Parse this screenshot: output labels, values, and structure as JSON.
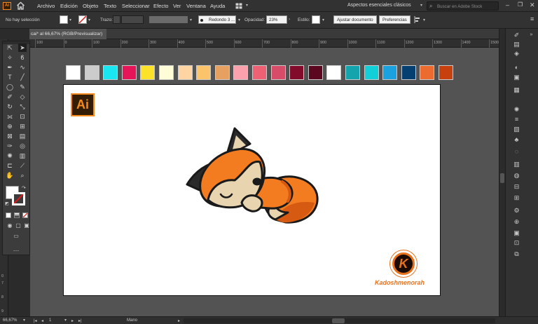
{
  "app": {
    "logo_text": "Ai",
    "home_icon": "home-icon"
  },
  "menu": {
    "items": [
      "Archivo",
      "Edición",
      "Objeto",
      "Texto",
      "Seleccionar",
      "Efecto",
      "Ver",
      "Ventana",
      "Ayuda"
    ],
    "workspace": "Aspectos esenciales clásicos",
    "search_placeholder": "Buscar en Adobe Stock"
  },
  "control": {
    "selection": "No hay selección",
    "stroke_label": "Trazo:",
    "brush": "Redondo 3 ...",
    "opacity_label": "Opacidad:",
    "opacity_value": "23%",
    "style_label": "Estilo:",
    "fit_button": "Ajustar documento",
    "prefs_button": "Preferencias"
  },
  "document": {
    "tab_title": "cai* al 66,67% (RGB/Previsualizar)"
  },
  "ruler": {
    "h_ticks": [
      "100",
      "0",
      "100",
      "200",
      "300",
      "400",
      "500",
      "600",
      "700",
      "800",
      "900",
      "1000",
      "1100",
      "1200",
      "1300",
      "1400",
      "1500"
    ],
    "v_ticks": [
      "0",
      "7",
      "8",
      "9"
    ]
  },
  "swatches": [
    "#ffffff",
    "#cccccc",
    "#19e6f0",
    "#e8145a",
    "#fde22a",
    "#fffcd8",
    "#fdd4a2",
    "#fbc46a",
    "#e6a161",
    "#fba1ad",
    "#ee6174",
    "#d74c68",
    "#820b2b",
    "#5b0720",
    "#ffffff",
    "#14a4ae",
    "#12d0d8",
    "#1aa1e0",
    "#053f71",
    "#ec6b2e",
    "#c7400e"
  ],
  "artboard": {
    "ai_badge": "Ai",
    "ai_badge_bg": "#331e05",
    "ai_badge_fg": "#f58b1f",
    "brand_letter": "K",
    "brand_name": "Kadoshmenorah",
    "brand_color": "#e8721c"
  },
  "status": {
    "zoom": "66,67%",
    "artboard_num": "1",
    "tool": "Mano"
  },
  "colors": {
    "fox_orange": "#f47c20",
    "fox_dark_orange": "#d65a12",
    "fox_cream": "#e8d5b0",
    "outline": "#1a1a1a"
  }
}
